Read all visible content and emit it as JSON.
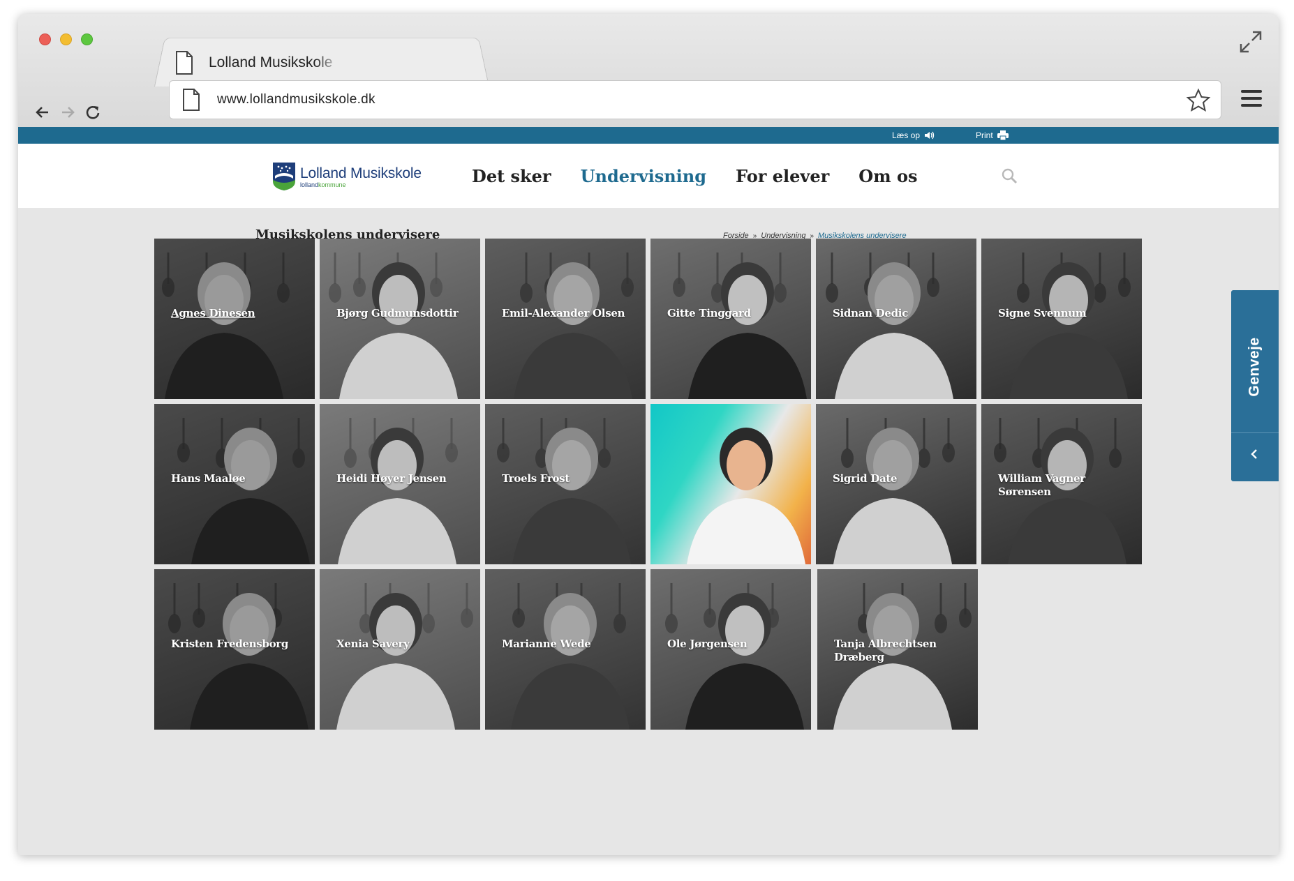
{
  "browser": {
    "tab_title": "Lolland Musikskole",
    "url": "www.lollandmusikskole.dk"
  },
  "utility": {
    "read_label": "Læs op",
    "print_label": "Print"
  },
  "logo": {
    "name": "Lolland Musikskole",
    "sub_prefix": "lolland",
    "sub_suffix": "kommune"
  },
  "nav": {
    "items": [
      "Det sker",
      "Undervisning",
      "For elever",
      "Om os"
    ],
    "active": "Undervisning"
  },
  "page": {
    "title": "Musikskolens undervisere"
  },
  "breadcrumb": {
    "items": [
      "Forside",
      "Undervisning",
      "Musikskolens undervisere"
    ],
    "separator": "»"
  },
  "teachers": [
    {
      "name": "Agnes Dinesen"
    },
    {
      "name": "Bjørg Gudmunsdottir"
    },
    {
      "name": "Emil-Alexander Olsen"
    },
    {
      "name": "Gitte Tinggard"
    },
    {
      "name": "Sidnan Dedic"
    },
    {
      "name": "Signe Svennum"
    },
    {
      "name": "Hans Maaløe"
    },
    {
      "name": "Heidi Høyer Jensen"
    },
    {
      "name": "Troels Frost"
    },
    {
      "name": ""
    },
    {
      "name": "Sigrid Date"
    },
    {
      "name": "William Vagner Sørensen"
    },
    {
      "name": "Kristen Fredensborg"
    },
    {
      "name": "Xenia Savery"
    },
    {
      "name": "Marianne Wede"
    },
    {
      "name": "Ole Jørgensen"
    },
    {
      "name": "Tanja Albrechtsen Dræberg"
    }
  ],
  "sidebar": {
    "label": "Genveje"
  },
  "colors": {
    "accent": "#1e6a8f",
    "sidebar": "#2a6f98",
    "logo_blue": "#1e3e7a",
    "logo_green": "#4aa43a"
  },
  "icons": [
    "document-icon",
    "expand-icon",
    "back-arrow-icon",
    "forward-arrow-icon",
    "reload-icon",
    "star-icon",
    "hamburger-menu-icon",
    "speaker-icon",
    "printer-icon",
    "search-icon",
    "chevron-left-icon"
  ]
}
